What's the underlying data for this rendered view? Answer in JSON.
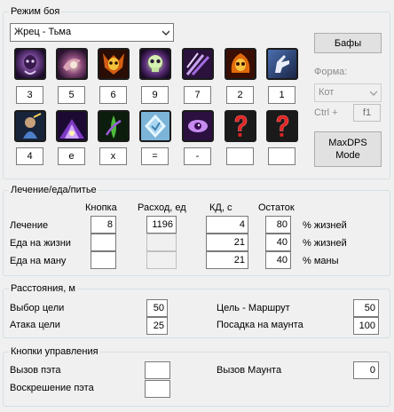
{
  "combat": {
    "title": "Режим боя",
    "class_select": "Жрец - Тьма",
    "buffs_button": "Бафы",
    "form_label": "Форма:",
    "form_select": "Кот",
    "hotkey_label": "Ctrl +",
    "hotkey_value": "f1",
    "maxdps_line1": "MaxDPS",
    "maxdps_line2": "Mode",
    "row1_keys": [
      "3",
      "5",
      "6",
      "9",
      "7",
      "2",
      "1"
    ],
    "row2_keys": [
      "4",
      "e",
      "x",
      "=",
      "-",
      "",
      ""
    ],
    "row1_icons": [
      "shadow-spirit-icon",
      "mind-vortex-icon",
      "demon-skull-icon",
      "green-skull-icon",
      "shadow-claws-icon",
      "fire-skull-icon",
      "pointing-hand-icon"
    ],
    "row2_icons": [
      "dwarf-warrior-icon",
      "shadow-nova-icon",
      "void-tendril-icon",
      "crystal-shield-icon",
      "shadow-eye-icon",
      "unknown-question-icon",
      "unknown-question-icon"
    ]
  },
  "healing": {
    "title": "Лечение/еда/питье",
    "col_key": "Кнопка",
    "col_cost": "Расход, ед",
    "col_cd": "КД, с",
    "col_remain": "Остаток",
    "rows": [
      {
        "label": "Лечение",
        "key": "8",
        "cost": "1196",
        "cd": "4",
        "remain": "80",
        "unit": "% жизней"
      },
      {
        "label": "Еда на жизни",
        "key": "",
        "cost": "",
        "cd": "21",
        "remain": "40",
        "unit": "% жизней"
      },
      {
        "label": "Еда на ману",
        "key": "",
        "cost": "",
        "cd": "21",
        "remain": "40",
        "unit": "% маны"
      }
    ]
  },
  "distances": {
    "title": "Расстояния, м",
    "target_select_label": "Выбор цели",
    "target_select_value": "50",
    "attack_target_label": "Атака цели",
    "attack_target_value": "25",
    "route_label": "Цель - Маршрут",
    "route_value": "50",
    "mount_label": "Посадка на маунта",
    "mount_value": "100"
  },
  "controls": {
    "title": "Кнопки управления",
    "call_pet_label": "Вызов пэта",
    "call_pet_value": "",
    "revive_pet_label": "Воскрешение пэта",
    "revive_pet_value": "",
    "call_mount_label": "Вызов Маунта",
    "call_mount_value": "0"
  }
}
